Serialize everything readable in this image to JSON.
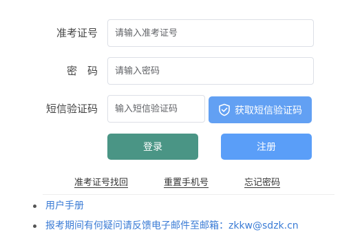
{
  "form": {
    "exam_id": {
      "label": "准考证号",
      "placeholder": "请输入准考证号",
      "value": ""
    },
    "password": {
      "label": "密　码",
      "placeholder": "请输入密码",
      "value": ""
    },
    "sms_code": {
      "label": "短信验证码",
      "placeholder": "输入短信验证码",
      "value": "",
      "get_code_button": "获取短信验证码",
      "icon": "shield-check-icon"
    },
    "login_button": "登录",
    "register_button": "注册"
  },
  "links": {
    "recover_exam_id": "准考证号找回",
    "reset_phone": "重置手机号",
    "forgot_password": "忘记密码"
  },
  "notices": {
    "user_manual": "用户手册",
    "contact": "报考期间有何疑问请反馈电子邮件至邮箱：zkkw@sdzk.cn"
  },
  "colors": {
    "login_button": "#4a9585",
    "register_button": "#5a9ef8",
    "sms_button": "#62a0f3",
    "link_text": "#3a7bd5"
  }
}
